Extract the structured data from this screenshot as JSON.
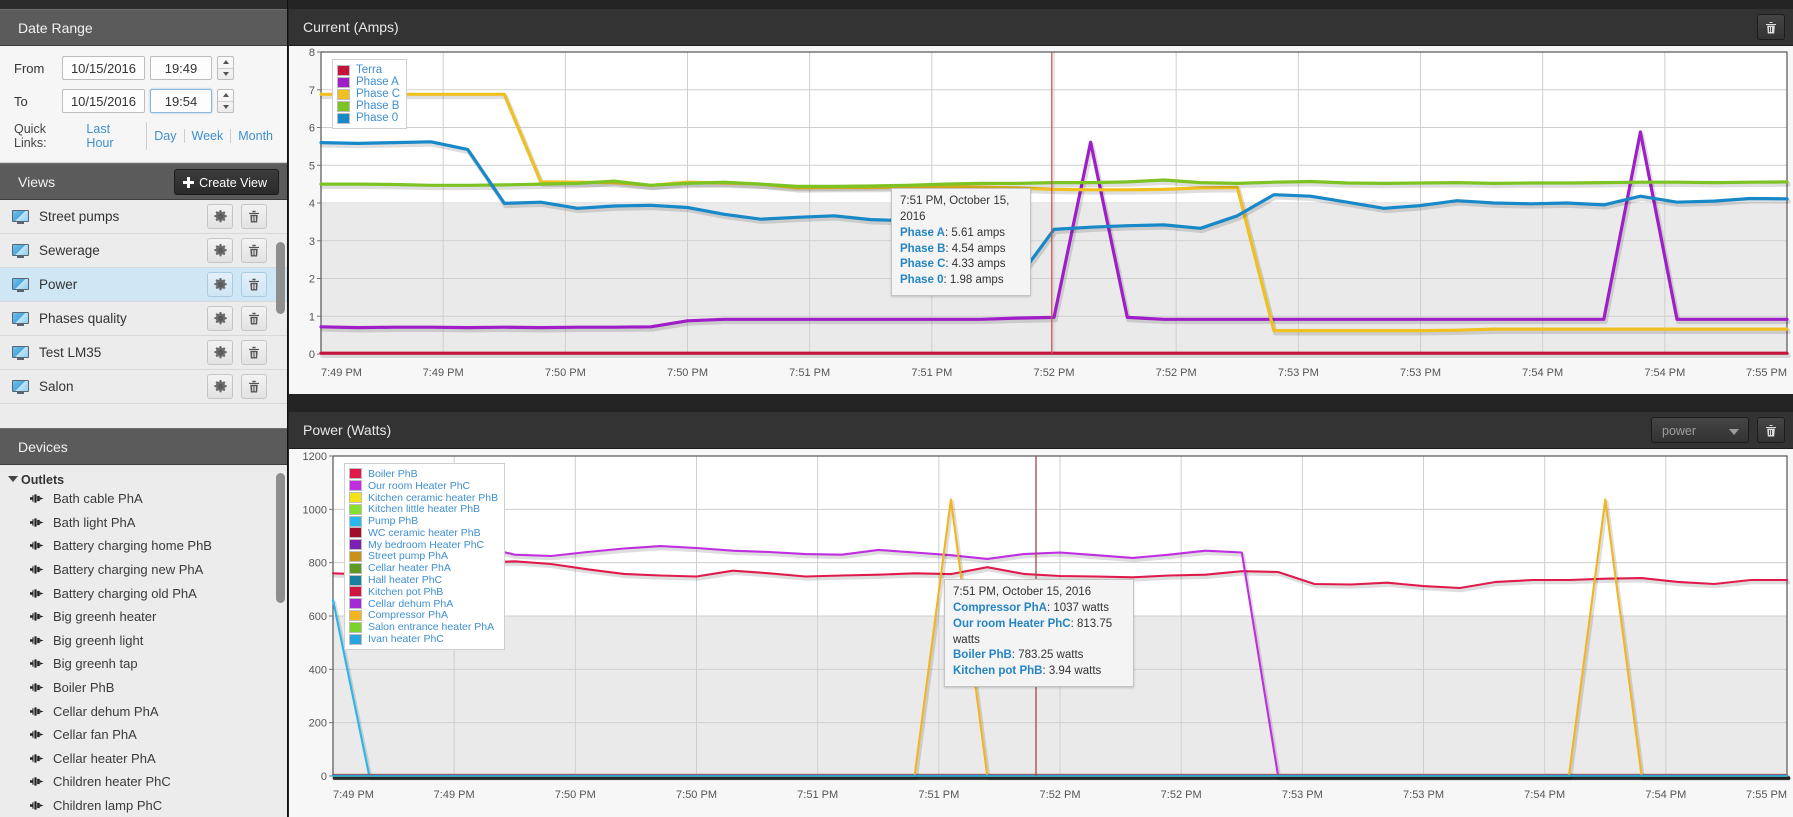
{
  "sidebar": {
    "date_range": {
      "title": "Date Range",
      "from_label": "From",
      "to_label": "To",
      "from_date": "10/15/2016",
      "from_time": "19:49",
      "to_date": "10/15/2016",
      "to_time": "19:54",
      "quick_links_label": "Quick Links:",
      "quick_links": [
        "Last Hour",
        "Day",
        "Week",
        "Month"
      ]
    },
    "views": {
      "title": "Views",
      "create_label": "Create View",
      "items": [
        {
          "label": "Street pumps",
          "selected": false
        },
        {
          "label": "Sewerage",
          "selected": false
        },
        {
          "label": "Power",
          "selected": true
        },
        {
          "label": "Phases quality",
          "selected": false
        },
        {
          "label": "Test LM35",
          "selected": false
        },
        {
          "label": "Salon",
          "selected": false
        }
      ]
    },
    "devices": {
      "title": "Devices",
      "group_label": "Outlets",
      "items": [
        "Bath cable PhA",
        "Bath light PhA",
        "Battery charging home PhB",
        "Battery charging new PhA",
        "Battery charging old PhA",
        "Big greenh heater",
        "Big greenh light",
        "Big greenh tap",
        "Boiler PhB",
        "Cellar dehum PhA",
        "Cellar fan PhA",
        "Cellar heater PhA",
        "Children heater PhC",
        "Children lamp PhC"
      ]
    }
  },
  "charts": {
    "current": {
      "title": "Current (Amps)",
      "tooltip": {
        "time": "7:51 PM, October 15, 2016",
        "rows": [
          {
            "name": "Phase A",
            "value": "5.61 amps"
          },
          {
            "name": "Phase B",
            "value": "4.54 amps"
          },
          {
            "name": "Phase C",
            "value": "4.33 amps"
          },
          {
            "name": "Phase 0",
            "value": "1.98 amps"
          }
        ]
      }
    },
    "power": {
      "title": "Power (Watts)",
      "selector_value": "power",
      "tooltip": {
        "time": "7:51 PM, October 15, 2016",
        "rows": [
          {
            "name": "Compressor PhA",
            "value": "1037 watts"
          },
          {
            "name": "Our room Heater PhC",
            "value": "813.75 watts"
          },
          {
            "name": "Boiler PhB",
            "value": "783.25 watts"
          },
          {
            "name": "Kitchen pot PhB",
            "value": "3.94 watts"
          }
        ]
      }
    }
  },
  "chart_data": [
    {
      "id": "current",
      "type": "line",
      "title": "Current (Amps)",
      "xlabel": "",
      "ylabel": "Amps",
      "ylim": [
        0,
        8
      ],
      "yticks": [
        0,
        1,
        2,
        3,
        4,
        5,
        6,
        7,
        8
      ],
      "xticks": [
        "7:49 PM",
        "7:49 PM",
        "7:50 PM",
        "7:50 PM",
        "7:51 PM",
        "7:51 PM",
        "7:52 PM",
        "7:52 PM",
        "7:53 PM",
        "7:53 PM",
        "7:54 PM",
        "7:54 PM",
        "7:55 PM"
      ],
      "grid": true,
      "legend_position": "top-left",
      "marker_time": "7:51 PM",
      "series": [
        {
          "name": "Terra",
          "color": "#c4143c",
          "values": [
            0.02,
            0.02,
            0.02,
            0.02,
            0.02,
            0.02,
            0.02,
            0.02,
            0.02,
            0.02,
            0.02,
            0.02,
            0.02,
            0.02,
            0.02,
            0.02,
            0.02,
            0.02,
            0.02,
            0.02,
            0.02,
            0.02,
            0.02,
            0.02,
            0.02,
            0.02,
            0.02,
            0.02,
            0.02,
            0.02,
            0.02,
            0.02,
            0.02,
            0.02,
            0.02,
            0.02,
            0.02,
            0.02,
            0.02,
            0.02,
            0.02
          ]
        },
        {
          "name": "Phase A",
          "color": "#a01ec8",
          "values": [
            0.72,
            0.7,
            0.71,
            0.71,
            0.7,
            0.71,
            0.7,
            0.71,
            0.71,
            0.72,
            0.88,
            0.92,
            0.92,
            0.92,
            0.92,
            0.92,
            0.92,
            0.92,
            0.92,
            0.95,
            0.97,
            5.61,
            0.97,
            0.92,
            0.92,
            0.92,
            0.92,
            0.92,
            0.92,
            0.92,
            0.92,
            0.92,
            0.92,
            0.92,
            0.92,
            0.92,
            5.88,
            0.92,
            0.92,
            0.92,
            0.92
          ]
        },
        {
          "name": "Phase C",
          "color": "#f0c020",
          "values": [
            6.88,
            6.88,
            6.88,
            6.88,
            6.88,
            6.88,
            4.56,
            4.55,
            4.54,
            4.47,
            4.55,
            4.53,
            4.5,
            4.4,
            4.41,
            4.41,
            4.42,
            4.44,
            4.42,
            4.4,
            4.36,
            4.35,
            4.35,
            4.36,
            4.4,
            4.41,
            0.62,
            0.62,
            0.62,
            0.62,
            0.62,
            0.63,
            0.66,
            0.66,
            0.66,
            0.66,
            0.66,
            0.66,
            0.66,
            0.66,
            0.66
          ]
        },
        {
          "name": "Phase B",
          "color": "#7cc424",
          "values": [
            4.5,
            4.5,
            4.49,
            4.47,
            4.47,
            4.48,
            4.5,
            4.52,
            4.58,
            4.47,
            4.52,
            4.55,
            4.5,
            4.44,
            4.44,
            4.45,
            4.47,
            4.5,
            4.52,
            4.52,
            4.54,
            4.54,
            4.56,
            4.61,
            4.54,
            4.52,
            4.55,
            4.57,
            4.53,
            4.52,
            4.53,
            4.54,
            4.52,
            4.53,
            4.53,
            4.54,
            4.55,
            4.55,
            4.54,
            4.55,
            4.56
          ]
        },
        {
          "name": "Phase 0",
          "color": "#1789c8",
          "values": [
            5.6,
            5.58,
            5.6,
            5.62,
            5.42,
            3.99,
            4.02,
            3.86,
            3.92,
            3.94,
            3.88,
            3.7,
            3.57,
            3.62,
            3.66,
            3.56,
            3.53,
            3.53,
            2.62,
            1.98,
            3.3,
            3.36,
            3.4,
            3.42,
            3.33,
            3.66,
            4.22,
            4.18,
            4.02,
            3.86,
            3.93,
            4.06,
            4.0,
            3.98,
            4.0,
            3.95,
            4.18,
            4.02,
            4.05,
            4.12,
            4.11
          ]
        }
      ]
    },
    {
      "id": "power",
      "type": "line",
      "title": "Power (Watts)",
      "xlabel": "",
      "ylabel": "Watts",
      "ylim": [
        0,
        1200
      ],
      "yticks": [
        0,
        200,
        400,
        600,
        800,
        1000,
        1200
      ],
      "xticks": [
        "7:49 PM",
        "7:49 PM",
        "7:50 PM",
        "7:50 PM",
        "7:51 PM",
        "7:51 PM",
        "7:52 PM",
        "7:52 PM",
        "7:53 PM",
        "7:53 PM",
        "7:54 PM",
        "7:54 PM",
        "7:55 PM"
      ],
      "grid": true,
      "legend_position": "top-left",
      "marker_time": "7:51 PM",
      "series": [
        {
          "name": "Boiler PhB",
          "color": "#e01b4c",
          "values": [
            760,
            755,
            748,
            770,
            800,
            805,
            795,
            775,
            758,
            752,
            748,
            770,
            760,
            748,
            752,
            755,
            760,
            757,
            783,
            758,
            750,
            748,
            745,
            752,
            755,
            768,
            765,
            720,
            718,
            725,
            712,
            705,
            728,
            735,
            735,
            740,
            742,
            728,
            720,
            735,
            735
          ]
        },
        {
          "name": "Our room Heater PhC",
          "color": "#bf2ee0",
          "values": [
            null,
            null,
            838,
            852,
            862,
            830,
            825,
            840,
            853,
            862,
            855,
            845,
            840,
            832,
            830,
            848,
            838,
            828,
            814,
            832,
            838,
            828,
            818,
            830,
            845,
            838,
            0,
            0,
            0,
            0,
            0,
            0,
            0,
            0,
            0,
            0,
            0,
            0,
            0,
            0,
            0
          ]
        },
        {
          "name": "Kitchen ceramic heater PhB",
          "color": "#f5e118",
          "values": [
            4,
            4,
            4,
            4,
            4,
            4,
            4,
            4,
            4,
            4,
            4,
            4,
            4,
            4,
            4,
            4,
            4,
            4,
            4,
            4,
            4,
            4,
            4,
            4,
            4,
            4,
            4,
            4,
            4,
            4,
            4,
            4,
            4,
            4,
            4,
            4,
            4,
            4,
            4,
            4,
            4
          ]
        },
        {
          "name": "Kitchen little heater PhB",
          "color": "#85e02e",
          "values": [
            2,
            2,
            2,
            2,
            2,
            2,
            2,
            2,
            2,
            2,
            2,
            2,
            2,
            2,
            2,
            2,
            2,
            2,
            2,
            2,
            2,
            2,
            2,
            2,
            2,
            2,
            2,
            2,
            2,
            2,
            2,
            2,
            2,
            2,
            2,
            2,
            2,
            2,
            2,
            2,
            2
          ]
        },
        {
          "name": "Pump PhB",
          "color": "#29b6ea",
          "values": [
            660,
            0,
            0,
            0,
            0,
            0,
            0,
            0,
            0,
            0,
            0,
            0,
            0,
            0,
            0,
            0,
            0,
            0,
            0,
            0,
            0,
            0,
            0,
            0,
            0,
            0,
            0,
            0,
            0,
            0,
            0,
            0,
            0,
            0,
            0,
            0,
            0,
            0,
            0,
            0,
            0
          ]
        },
        {
          "name": "WC ceramic heater PhB",
          "color": "#a00e2c",
          "values": [
            3,
            3,
            3,
            3,
            3,
            3,
            3,
            3,
            3,
            3,
            3,
            3,
            3,
            3,
            3,
            3,
            3,
            3,
            3,
            3,
            3,
            3,
            3,
            3,
            3,
            3,
            3,
            3,
            3,
            3,
            3,
            3,
            3,
            3,
            3,
            3,
            3,
            3,
            3,
            3,
            3
          ]
        },
        {
          "name": "My bedroom Heater PhC",
          "color": "#7b20b0",
          "values": [
            2,
            2,
            2,
            2,
            2,
            2,
            2,
            2,
            2,
            2,
            2,
            2,
            2,
            2,
            2,
            2,
            2,
            2,
            2,
            2,
            2,
            2,
            2,
            2,
            2,
            2,
            2,
            2,
            2,
            2,
            2,
            2,
            2,
            2,
            2,
            2,
            2,
            2,
            2,
            2,
            2
          ]
        },
        {
          "name": "Street pump PhA",
          "color": "#c79217",
          "values": [
            1,
            1,
            1,
            1,
            1,
            1,
            1,
            1,
            1,
            1,
            1,
            1,
            1,
            1,
            1,
            1,
            1,
            1,
            1,
            1,
            1,
            1,
            1,
            1,
            1,
            1,
            1,
            1,
            1,
            1,
            1,
            1,
            1,
            1,
            1,
            1,
            1,
            1,
            1,
            1,
            1
          ]
        },
        {
          "name": "Cellar heater PhA",
          "color": "#5c9a22",
          "values": [
            1,
            1,
            1,
            1,
            1,
            1,
            1,
            1,
            1,
            1,
            1,
            1,
            1,
            1,
            1,
            1,
            1,
            1,
            1,
            1,
            1,
            1,
            1,
            1,
            1,
            1,
            1,
            1,
            1,
            1,
            1,
            1,
            1,
            1,
            1,
            1,
            1,
            1,
            1,
            1,
            1
          ]
        },
        {
          "name": "Hall heater PhC",
          "color": "#1a7fa0",
          "values": [
            1,
            1,
            1,
            1,
            1,
            1,
            1,
            1,
            1,
            1,
            1,
            1,
            1,
            1,
            1,
            1,
            1,
            1,
            1,
            1,
            1,
            1,
            1,
            1,
            1,
            1,
            1,
            1,
            1,
            1,
            1,
            1,
            1,
            1,
            1,
            1,
            1,
            1,
            1,
            1,
            1
          ]
        },
        {
          "name": "Kitchen pot PhB",
          "color": "#cf1540",
          "values": [
            3.94,
            3.94,
            3.94,
            3.94,
            3.94,
            3.94,
            3.94,
            3.94,
            3.94,
            3.94,
            3.94,
            3.94,
            3.94,
            3.94,
            3.94,
            3.94,
            3.94,
            3.94,
            3.94,
            3.94,
            3.94,
            3.94,
            3.94,
            3.94,
            3.94,
            3.94,
            3.94,
            3.94,
            3.94,
            3.94,
            3.94,
            3.94,
            3.94,
            3.94,
            3.94,
            3.94,
            3.94,
            3.94,
            3.94,
            3.94,
            3.94
          ]
        },
        {
          "name": "Cellar dehum PhA",
          "color": "#a32ad6",
          "values": [
            2,
            2,
            2,
            2,
            2,
            2,
            2,
            2,
            2,
            2,
            2,
            2,
            2,
            2,
            2,
            2,
            2,
            2,
            2,
            2,
            2,
            2,
            2,
            2,
            2,
            2,
            2,
            2,
            2,
            2,
            2,
            2,
            2,
            2,
            2,
            2,
            2,
            2,
            2,
            2,
            2
          ]
        },
        {
          "name": "Compressor PhA",
          "color": "#f2b520",
          "values": [
            0,
            0,
            0,
            0,
            0,
            0,
            0,
            0,
            0,
            0,
            0,
            0,
            0,
            0,
            0,
            0,
            0,
            1037,
            0,
            0,
            0,
            0,
            0,
            0,
            0,
            0,
            0,
            0,
            0,
            0,
            0,
            0,
            0,
            0,
            0,
            1037,
            0,
            0,
            0,
            0,
            0
          ]
        },
        {
          "name": "Salon entrance heater PhA",
          "color": "#7bd22a",
          "values": [
            1,
            1,
            1,
            1,
            1,
            1,
            1,
            1,
            1,
            1,
            1,
            1,
            1,
            1,
            1,
            1,
            1,
            1,
            1,
            1,
            1,
            1,
            1,
            1,
            1,
            1,
            1,
            1,
            1,
            1,
            1,
            1,
            1,
            1,
            1,
            1,
            1,
            1,
            1,
            1,
            1
          ]
        },
        {
          "name": "Ivan heater PhC",
          "color": "#2aa5dc",
          "values": [
            1,
            1,
            1,
            1,
            1,
            1,
            1,
            1,
            1,
            1,
            1,
            1,
            1,
            1,
            1,
            1,
            1,
            1,
            1,
            1,
            1,
            1,
            1,
            1,
            1,
            1,
            1,
            1,
            1,
            1,
            1,
            1,
            1,
            1,
            1,
            1,
            1,
            1,
            1,
            1,
            1
          ]
        }
      ]
    }
  ]
}
